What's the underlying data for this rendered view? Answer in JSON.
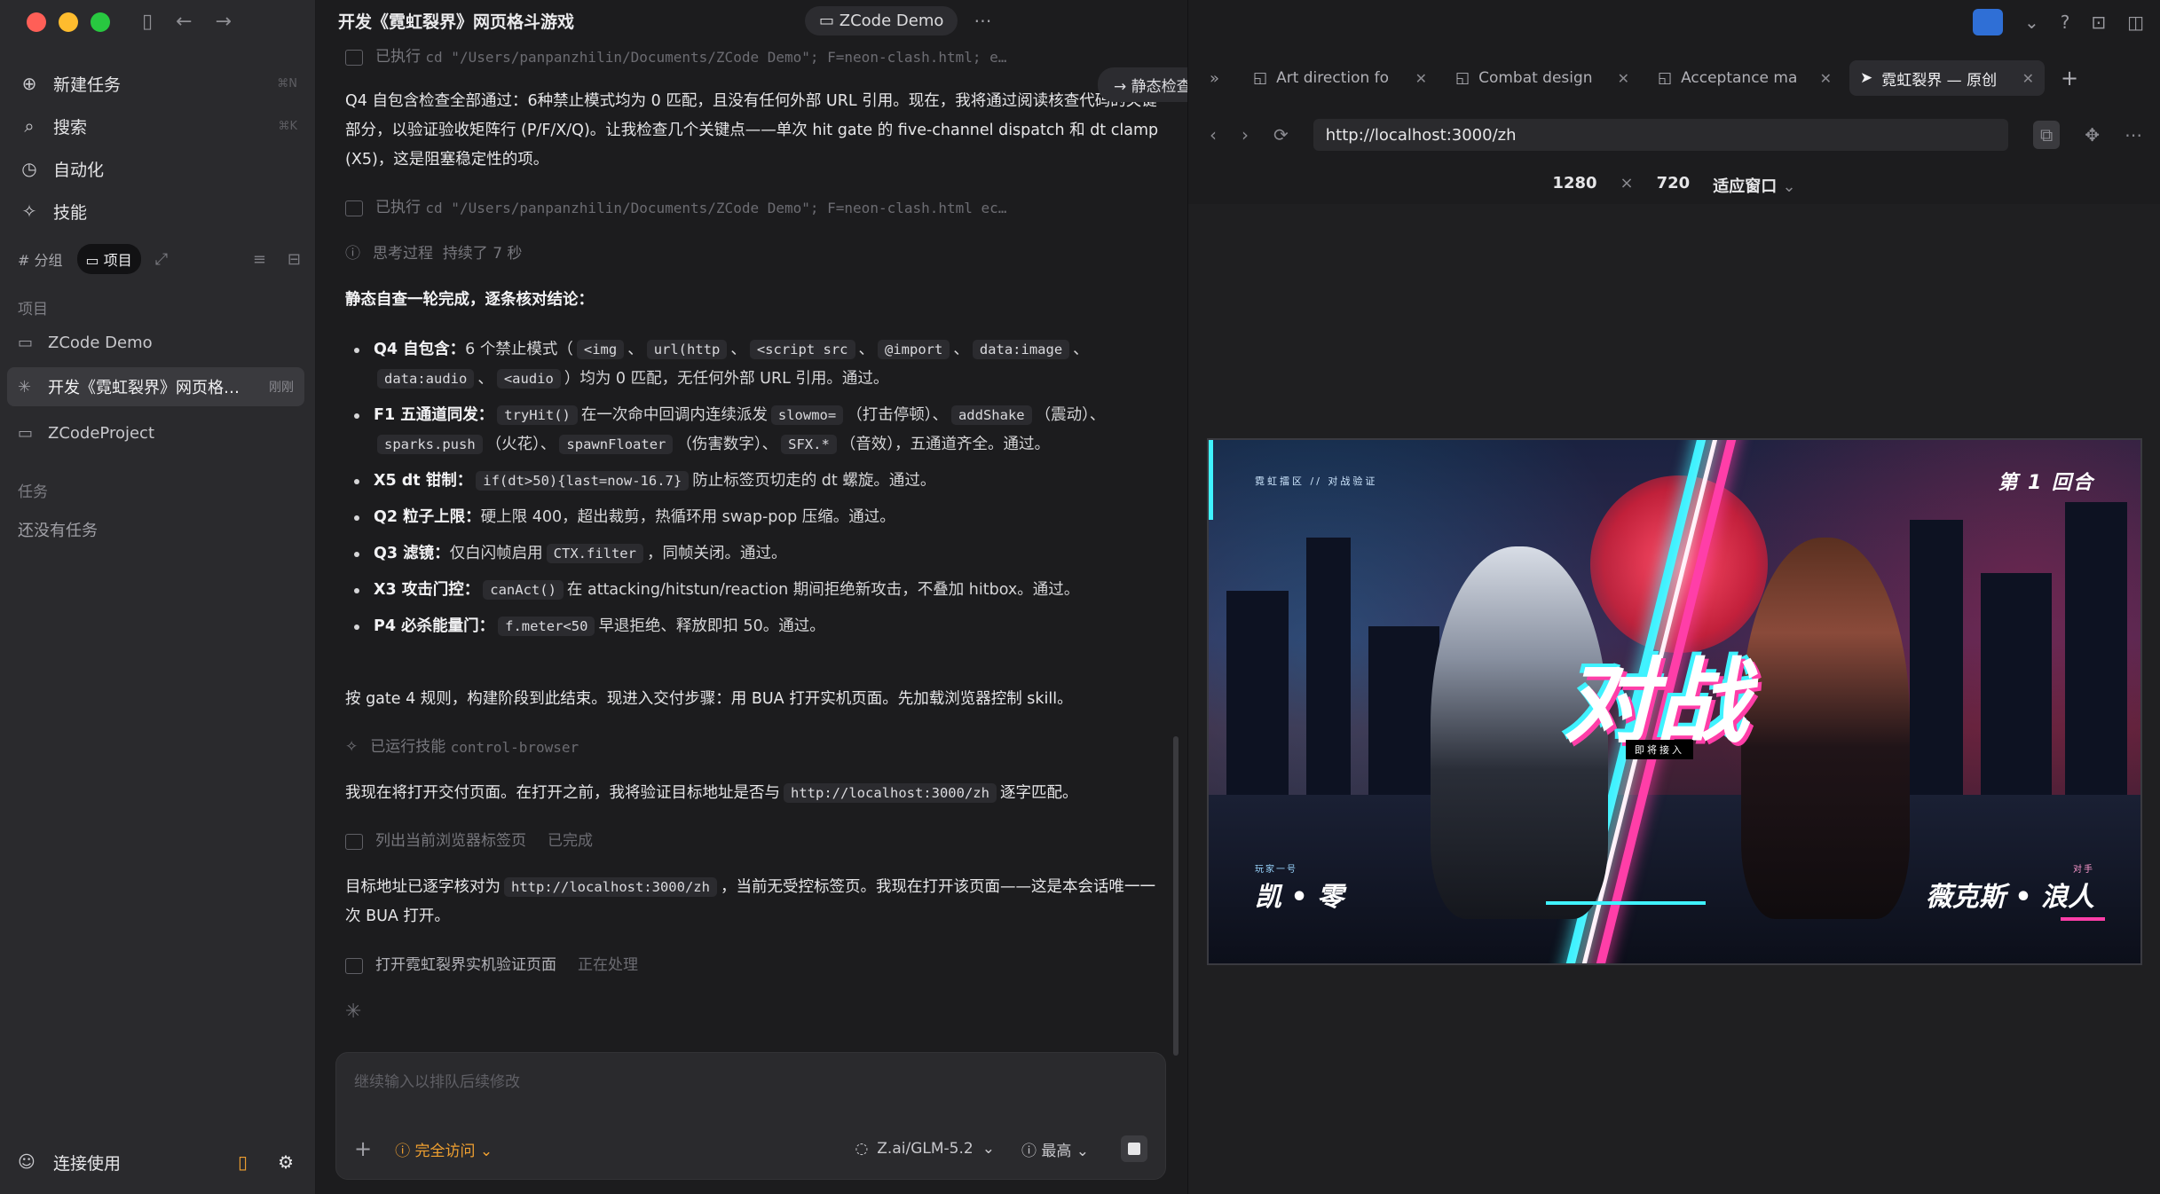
{
  "sidebar": {
    "nav": [
      {
        "icon": "new-task-icon",
        "label": "新建任务",
        "shortcut": "⌘N"
      },
      {
        "icon": "search-icon",
        "label": "搜索",
        "shortcut": "⌘K"
      },
      {
        "icon": "automation-icon",
        "label": "自动化",
        "shortcut": ""
      },
      {
        "icon": "skills-icon",
        "label": "技能",
        "shortcut": ""
      }
    ],
    "filters": {
      "group": "# 分组",
      "project": "项目"
    },
    "projects_label": "项目",
    "projects": [
      {
        "label": "ZCode Demo",
        "badge": ""
      },
      {
        "label": "开发《霓虹裂界》网页格…",
        "badge": "刚刚"
      },
      {
        "label": "ZCodeProject",
        "badge": ""
      }
    ],
    "tasks_label": "任务",
    "tasks_empty": "还没有任务",
    "account": "连接使用"
  },
  "chat": {
    "title": "开发《霓虹裂界》网页格斗游戏",
    "project_chip": "ZCode Demo",
    "toast": "静态检查：确认零外部依赖，逐条核对验收…",
    "tool1": {
      "label": "已执行",
      "cmd": "cd \"/Users/panpanzhilin/Documents/ZCode Demo\"; F=neon-clash.html; e…"
    },
    "para1": "Q4 自包含检查全部通过：6种禁止模式均为 0 匹配，且没有任何外部 URL 引用。现在，我将通过阅读核查代码的关键部分，以验证验收矩阵行 (P/F/X/Q)。让我检查几个关键点——单次 hit gate 的 five-channel dispatch 和 dt clamp (X5)，这是阻塞稳定性的项。",
    "tool2": {
      "label": "已执行",
      "cmd": "cd \"/Users/panpanzhilin/Documents/ZCode Demo\"; F=neon-clash.html ec…"
    },
    "thinking": {
      "label": "思考过程",
      "duration": "持续了 7 秒"
    },
    "summary_head": "静态自查一轮完成，逐条核对结论：",
    "checks": {
      "q4": {
        "head": "Q4 自包含：",
        "t1": "6 个禁止模式（",
        "c1": "<img",
        "c2": "url(http",
        "c3": "<script src",
        "c4": "@import",
        "c5": "data:image",
        "c6": "data:audio",
        "c7": "<audio",
        "t2": "）均为 0 匹配，无任何外部 URL 引用。通过。"
      },
      "f1": {
        "head": "F1 五通道同发：",
        "c1": "tryHit()",
        "t1": "在一次命中回调内连续派发",
        "c2": "slowmo=",
        "t2": "（打击停顿）、",
        "c3": "addShake",
        "t3": "（震动）、",
        "c4": "sparks.push",
        "t4": "（火花）、",
        "c5": "spawnFloater",
        "t5": "（伤害数字）、",
        "c6": "SFX.*",
        "t6": "（音效），五通道齐全。通过。"
      },
      "x5": {
        "head": "X5 dt 钳制：",
        "c1": "if(dt>50){last=now-16.7}",
        "t1": "防止标签页切走的 dt 螺旋。通过。"
      },
      "q2": {
        "head": "Q2 粒子上限：",
        "t1": "硬上限 400，超出裁剪，热循环用 swap-pop 压缩。通过。"
      },
      "q3": {
        "head": "Q3 滤镜：",
        "t1": "仅白闪帧启用",
        "c1": "CTX.filter",
        "t2": "，同帧关闭。通过。"
      },
      "x3": {
        "head": "X3 攻击门控：",
        "c1": "canAct()",
        "t1": "在 attacking/hitstun/reaction 期间拒绝新攻击，不叠加 hitbox。通过。"
      },
      "p4": {
        "head": "P4 必杀能量门：",
        "c1": "f.meter<50",
        "t1": "早退拒绝、释放即扣 50。通过。"
      }
    },
    "para2": "按 gate 4 规则，构建阶段到此结束。现进入交付步骤：用 BUA 打开实机页面。先加载浏览器控制 skill。",
    "skill": {
      "label": "已运行技能",
      "name": "control-browser"
    },
    "para3": {
      "t1": "我现在将打开交付页面。在打开之前，我将验证目标地址是否与",
      "c1": "http://localhost:3000/zh",
      "t2": "逐字匹配。"
    },
    "tool3": {
      "label": "列出当前浏览器标签页",
      "state": "已完成"
    },
    "para4": {
      "t1": "目标地址已逐字核对为",
      "c1": "http://localhost:3000/zh",
      "t2": "，当前无受控标签页。我现在打开该页面——这是本会话唯一一次 BUA 打开。"
    },
    "tool4": {
      "label": "打开霓虹裂界实机验证页面",
      "state": "正在处理"
    },
    "composer": {
      "placeholder": "继续输入以排队后续修改",
      "access": "完全访问",
      "model": "Z.ai/GLM-5.2",
      "effort": "最高"
    }
  },
  "browser": {
    "tabs": [
      {
        "label": "Art direction fo",
        "active": false
      },
      {
        "label": "Combat design",
        "active": false
      },
      {
        "label": "Acceptance ma",
        "active": false
      },
      {
        "label": "霓虹裂界 — 原创",
        "active": true
      }
    ],
    "url": "http://localhost:3000/zh",
    "viewport": {
      "width": "1280",
      "x": "×",
      "height": "720",
      "fit": "适应窗口"
    },
    "game": {
      "hud_left": "霓虹擂区 // 对战验证",
      "round": "第 1 回合",
      "vs": "对战",
      "vs_sub": "即将接入",
      "p1_small": "玩家一号",
      "p1": "凯 • 零",
      "p2_small": "对手",
      "p2": "薇克斯 • 浪人"
    }
  },
  "colors": {
    "accent_orange": "#f0a030",
    "neon_cyan": "#3ff2ff",
    "neon_pink": "#ff3ea8"
  }
}
